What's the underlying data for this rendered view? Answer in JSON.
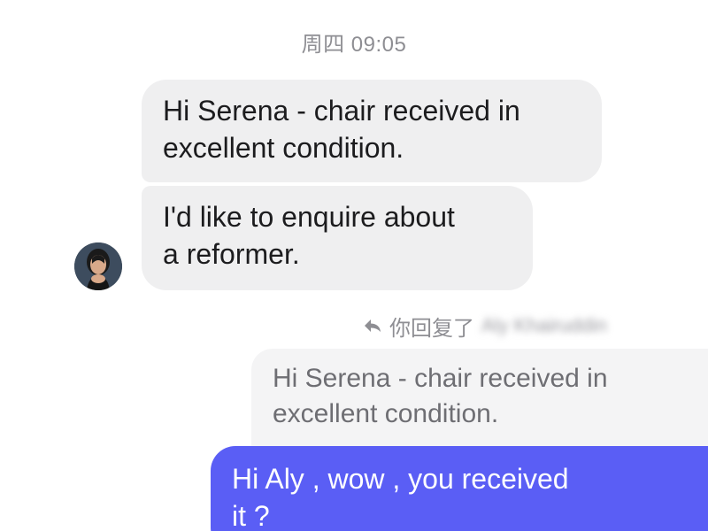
{
  "conversation": {
    "timestamp": "周四 09:05",
    "messages_in": [
      {
        "text": "Hi Serena - chair received in\nexcellent condition."
      },
      {
        "text": "I'd like to enquire about\na reformer."
      }
    ],
    "contact": {
      "avatar_icon": "contact-avatar"
    },
    "reply": {
      "icon": "reply-arrow-icon",
      "label": "你回复了",
      "recipient_name": "Aly Khairuddin",
      "quoted_text": "Hi Serena - chair received in\nexcellent condition."
    },
    "message_out": {
      "text": "Hi Aly ,    wow , you received\nit ?"
    }
  },
  "colors": {
    "incoming_bubble": "#efeff0",
    "quoted_bubble": "#f4f4f5",
    "outgoing_bubble": "#5a5ef5",
    "meta_text": "#8e8e93"
  }
}
